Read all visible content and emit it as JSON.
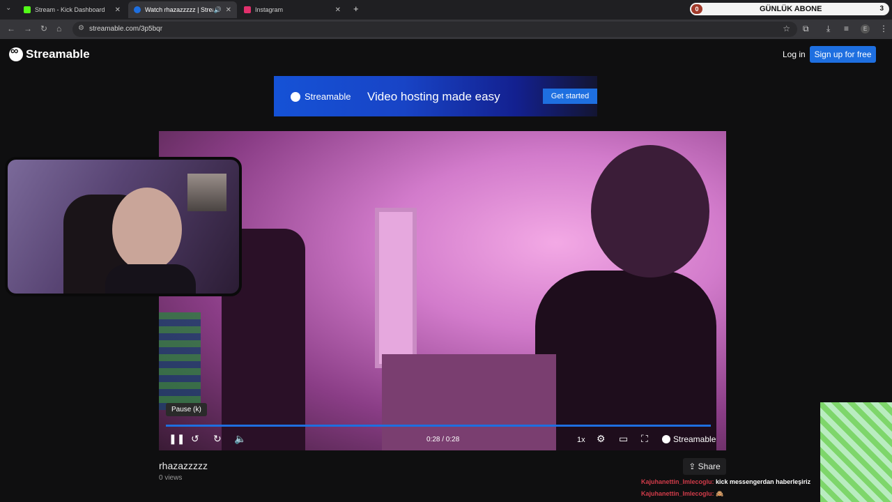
{
  "browser": {
    "tabs": [
      {
        "title": "Stream - Kick Dashboard",
        "active": false,
        "favicon_color": "#53fc18"
      },
      {
        "title": "Watch rhazazzzzz | Streama",
        "active": true,
        "favicon_color": "#1e6fe0"
      },
      {
        "title": "Instagram",
        "active": false,
        "favicon_color": "#e1306c"
      }
    ],
    "new_tab": "+",
    "url": "streamable.com/3p5bqr"
  },
  "overlay": {
    "abone_count": "0",
    "abone_label": "GÜNLÜK ABONE",
    "abone_right": "3"
  },
  "site": {
    "brand": "Streamable",
    "login": "Log in",
    "signup": "Sign up for free"
  },
  "ad": {
    "brand": "Streamable",
    "tagline": "Video hosting made easy",
    "cta": "Get started",
    "gradient": [
      "#1552d6",
      "#131532"
    ]
  },
  "player": {
    "tooltip": "Pause (k)",
    "time": "0:28 / 0:28",
    "speed": "1x",
    "brand": "Streamable",
    "progress": 1.0,
    "accent": "#1e6fe0"
  },
  "video": {
    "title": "rhazazzzzz",
    "views": "0 views",
    "share": "Share"
  },
  "chat": [
    {
      "user": "Kajuhanettin_Imlecoglu:",
      "message": "kick messengerdan haberleşiriz"
    },
    {
      "user": "Kajuhanettin_Imlecoglu:",
      "message": ""
    }
  ]
}
